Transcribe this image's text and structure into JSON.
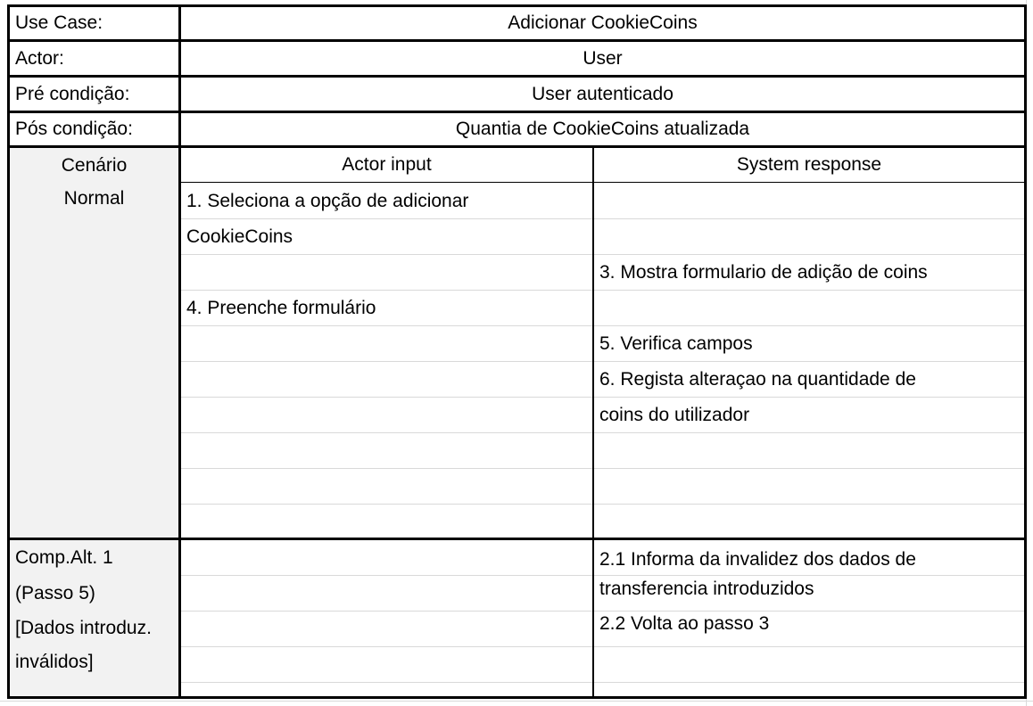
{
  "header": {
    "use_case_label": "Use Case:",
    "use_case_value": "Adicionar CookieCoins",
    "actor_label": "Actor:",
    "actor_value": "User",
    "pre_label": "Pré condição:",
    "pre_value": "User autenticado",
    "pos_label": "Pós condição:",
    "pos_value": "Quantia de CookieCoins atualizada"
  },
  "normal": {
    "label_line1": "Cenário",
    "label_line2": "Normal",
    "actor_header": "Actor input",
    "system_header": "System response",
    "actor_steps": [
      "1. Seleciona a opção de adicionar",
      "CookieCoins",
      "",
      "4. Preenche formulário"
    ],
    "system_steps": [
      "3. Mostra formulario de adição de coins",
      "",
      "5. Verifica campos",
      "6. Regista alteraçao na quantidade de",
      "coins do utilizador"
    ]
  },
  "alt": {
    "label_lines": [
      "Comp.Alt. 1",
      "(Passo 5)",
      "[Dados introduz.",
      "inválidos]"
    ],
    "system_steps": [
      "2.1 Informa da invalidez dos dados de",
      "transferencia introduzidos",
      "2.2 Volta ao passo 3"
    ]
  }
}
